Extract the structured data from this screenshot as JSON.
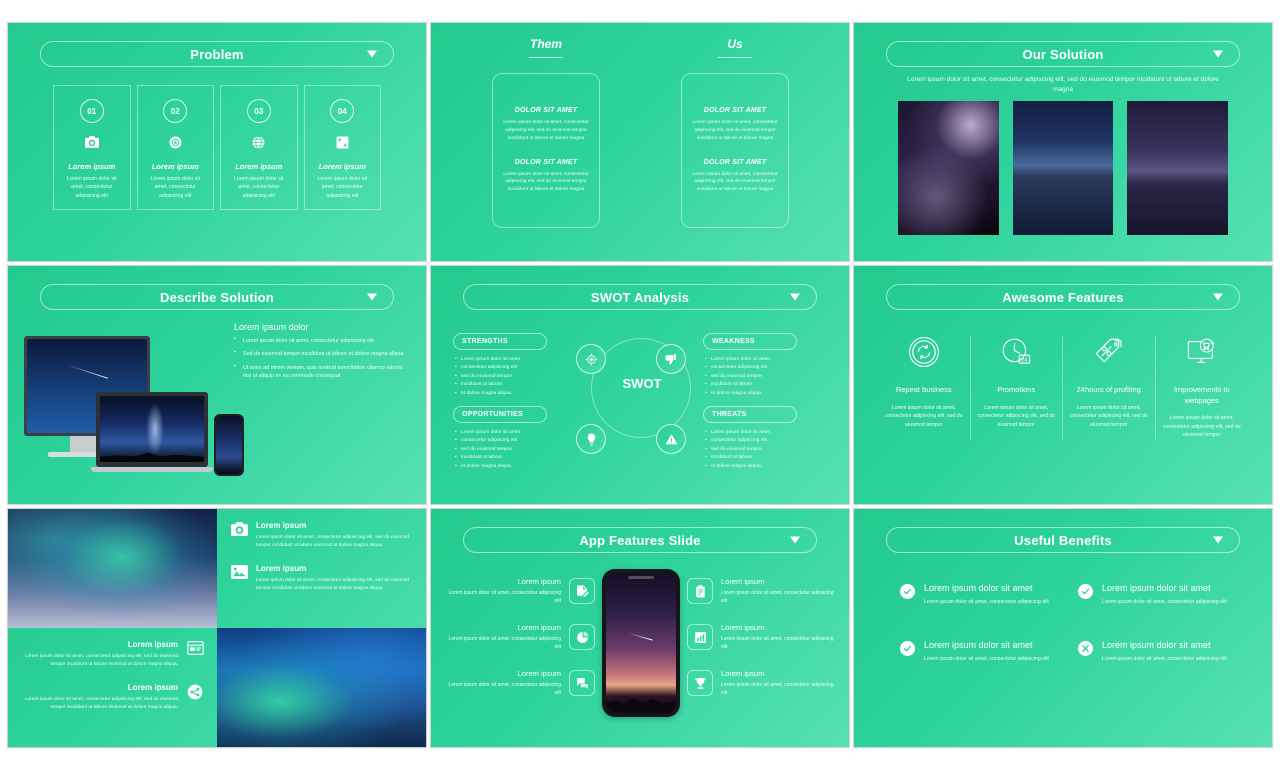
{
  "theme": {
    "accent_green_dark": "#24c98e",
    "accent_green_light": "#57e0b4",
    "text_white": "#ffffff"
  },
  "slides": [
    {
      "id": "problem",
      "title": "Problem",
      "caret": "chevron-down-icon",
      "cards": [
        {
          "num": "01",
          "icon": "camera-icon",
          "heading": "Lorem ipsum",
          "body": "Lorem ipsum dolor sit amet, consectetur adipisicing elit"
        },
        {
          "num": "02",
          "icon": "lens-icon",
          "heading": "Lorem ipsum",
          "body": "Lorem ipsum dolor sit amet, consectetur adipisicing elit"
        },
        {
          "num": "03",
          "icon": "globe-icon",
          "heading": "Lorem ipsum",
          "body": "Lorem ipsum dolor sit amet, consectetur adipisicing elit"
        },
        {
          "num": "04",
          "icon": "expand-icon",
          "heading": "Lorem ipsum",
          "body": "Lorem ipsum dolor sit amet, consectetur adipisicing elit"
        }
      ]
    },
    {
      "id": "them-us",
      "columns": [
        {
          "title": "Them",
          "blocks": [
            {
              "heading": "DOLOR SIT AMET",
              "body": "Lorem ipsum dolor sit amet, consectetur adipiscing elit, sed do eiusmod tempor incididunt ut labore et dolore magna"
            },
            {
              "heading": "DOLOR SIT AMET",
              "body": "Lorem ipsum dolor sit amet, consectetur adipiscing elit, sed do eiusmod tempor incididunt ut labore et dolore magna"
            }
          ]
        },
        {
          "title": "Us",
          "blocks": [
            {
              "heading": "DOLOR SIT AMET",
              "body": "Lorem ipsum dolor sit amet, consectetur adipiscing elit, sed do eiusmod tempor incididunt ut labore et dolore magna"
            },
            {
              "heading": "DOLOR SIT AMET",
              "body": "Lorem ipsum dolor sit amet, consectetur adipiscing elit, sed do eiusmod tempor incididunt ut labore et dolore magna"
            }
          ]
        }
      ]
    },
    {
      "id": "our-solution",
      "title": "Our Solution",
      "caret": "chevron-down-icon",
      "subtitle": "Lorem ipsum dolor sit amet, consectetur adipiscing elit, sed do eiusmod tempor incididunt ut labore et dolore magna",
      "images": [
        "milky-way-photo",
        "mountain-lake-photo",
        "twilight-lake-photo"
      ]
    },
    {
      "id": "describe-solution",
      "title": "Describe Solution",
      "caret": "chevron-down-icon",
      "heading": "Lorem ipsum dolor",
      "bullets": [
        "Lorem ipsum dolor sit amet, consectetur adipisicing elit",
        "Sed do eiusmod tempor incididunt ut labore et dolore magna aliqua",
        "Ut enim ad minim veniam, quis nostrud exercitation ullamco laboris nisi ut aliquip ex ea commodo consequat"
      ],
      "devices": [
        "desktop-monitor-mockup",
        "laptop-mockup",
        "smartphone-mockup"
      ]
    },
    {
      "id": "swot-analysis",
      "title": "SWOT Analysis",
      "caret": "chevron-down-icon",
      "center_label": "SWOT",
      "quadrants": [
        {
          "label": "STRENGTHS",
          "icon": "target-icon",
          "items": [
            "Lorem ipsum dolor sit amet",
            "consectetur adipiscing elit",
            "sed do eiusmod tempor",
            "incididunt ut labore",
            "et dolore magna aliqua."
          ]
        },
        {
          "label": "WEAKNESS",
          "icon": "thumbs-down-icon",
          "items": [
            "Lorem ipsum dolor sit amet",
            "consectetur adipiscing elit",
            "sed do eiusmod tempor",
            "incididunt ut labore",
            "et dolore magna aliqua."
          ]
        },
        {
          "label": "OPPORTUNITIES",
          "icon": "lightbulb-icon",
          "items": [
            "Lorem ipsum dolor sit amet",
            "consectetur adipiscing elit",
            "sed do eiusmod tempor",
            "incididunt ut labore",
            "et dolore magna aliqua."
          ]
        },
        {
          "label": "THREATS",
          "icon": "warning-icon",
          "items": [
            "Lorem ipsum dolor sit amet",
            "consectetur adipiscing elit",
            "sed do eiusmod tempor",
            "incididunt ut labore",
            "et dolore magna aliqua."
          ]
        }
      ]
    },
    {
      "id": "awesome-features",
      "title": "Awesome Features",
      "caret": "chevron-down-icon",
      "features": [
        {
          "icon": "refresh-cycle-icon",
          "heading": "Repeat business",
          "body": "Lorem ipsum dolor sit amet, consectetur adipiscing elit, sed do eiusmod tempor"
        },
        {
          "icon": "clock-24h-icon",
          "heading": "Promotions",
          "body": "Lorem ipsum dolor sit amet, consectetur adipiscing elit, sed do eiusmod tempor"
        },
        {
          "icon": "price-tag-icon",
          "heading": "24hours of profiting",
          "body": "Lorem ipsum dolor sit amet, consectetur adipiscing elit, sed do eiusmod tempor"
        },
        {
          "icon": "ecommerce-monitor-icon",
          "heading": "Improvements to webpages",
          "body": "Lorem ipsum dolor sit amet, consectetur adipiscing elit, sed do eiusmod tempor"
        }
      ]
    },
    {
      "id": "image-quad",
      "images": [
        "aurora-snowfield-photo",
        "aurora-mountain-photo"
      ],
      "top_items": [
        {
          "icon": "camera-icon",
          "heading": "Lorem ipsum",
          "body": "Lorem ipsum dolor sit amet, consectetur adipisicing elit, sed do eiusmod tempor incididunt ut labore eiusmod at dolore magna aliqua."
        },
        {
          "icon": "picture-icon",
          "heading": "Lorem ipsum",
          "body": "Lorem ipsum dolor sit amet, consectetur adipisicing elit, sed do eiusmod tempor incididunt ut labore eiusmod at dolore magna aliqua."
        }
      ],
      "bottom_items": [
        {
          "icon": "browser-window-icon",
          "heading": "Lorem ipsum",
          "body": "Lorem ipsum dolor sit amet, consectetur adipisicing elit, sed do eiusmod tempor incididunt ut labore eiusmod at dolore magna aliqua."
        },
        {
          "icon": "share-icon",
          "heading": "Lorem ipsum",
          "body": "Lorem ipsum dolor sit amet, consectetur adipisicing elit, sed do eiusmod tempor incididunt ut labore eiusmod at dolore magna aliqua."
        }
      ]
    },
    {
      "id": "app-features",
      "title": "App Features Slide",
      "caret": "chevron-down-icon",
      "device": "smartphone-sunset-mockup",
      "left_items": [
        {
          "icon": "document-edit-icon",
          "heading": "Lorem ipsum",
          "body": "Lorem ipsum dolor sit amet, consectetur adipiscing elit"
        },
        {
          "icon": "pie-chart-icon",
          "heading": "Lorem ipsum",
          "body": "Lorem ipsum dolor sit amet, consectetur adipiscing elit"
        },
        {
          "icon": "chat-bubbles-icon",
          "heading": "Lorem ipsum",
          "body": "Lorem ipsum dolor sit amet, consectetur adipiscing elit"
        }
      ],
      "right_items": [
        {
          "icon": "clipboard-icon",
          "heading": "Lorem ipsum",
          "body": "Lorem ipsum dolor sit amet, consectetur adipiscing elit"
        },
        {
          "icon": "bar-chart-doc-icon",
          "heading": "Lorem ipsum",
          "body": "Lorem ipsum dolor sit amet, consectetur adipiscing elit"
        },
        {
          "icon": "trophy-icon",
          "heading": "Lorem ipsum",
          "body": "Lorem ipsum dolor sit amet, consectetur adipiscing elit"
        }
      ]
    },
    {
      "id": "useful-benefits",
      "title": "Useful Benefits",
      "caret": "chevron-down-icon",
      "benefits": [
        {
          "icon": "check-circle-icon",
          "heading": "Lorem ipsum dolor sit amet",
          "body": "Lorem ipsum dolor sit amet, consectetur adipiscing elit"
        },
        {
          "icon": "check-circle-icon",
          "heading": "Lorem ipsum dolor sit amet",
          "body": "Lorem ipsum dolor sit amet, consectetur adipiscing elit"
        },
        {
          "icon": "check-circle-icon",
          "heading": "Lorem ipsum dolor sit amet",
          "body": "Lorem ipsum dolor sit amet, consectetur adipiscing elit"
        },
        {
          "icon": "cross-circle-icon",
          "heading": "Lorem ipsum dolor sit amet",
          "body": "Lorem ipsum dolor sit amet, consectetur adipiscing elit"
        }
      ]
    }
  ]
}
